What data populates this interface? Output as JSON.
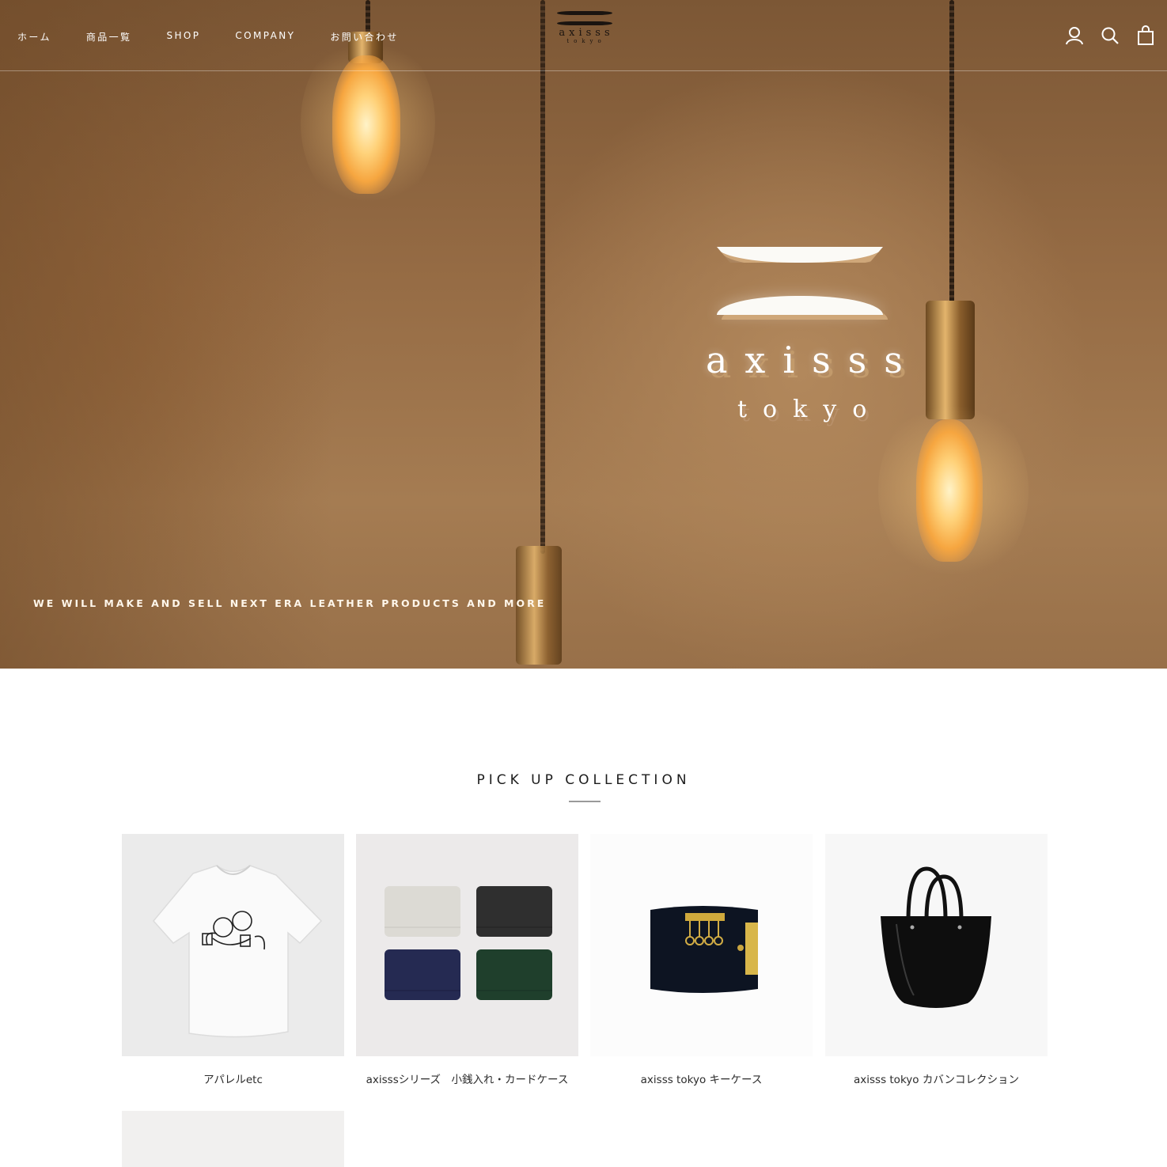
{
  "header": {
    "nav": [
      "ホーム",
      "商品一覧",
      "SHOP",
      "COMPANY",
      "お問い合わせ"
    ],
    "logo": {
      "word": "axisss",
      "sub": "tokyo"
    },
    "icons": [
      "account-icon",
      "search-icon",
      "cart-icon"
    ]
  },
  "hero": {
    "sign_word": "axisss",
    "sign_sub": "tokyo",
    "tagline": "WE WILL MAKE AND SELL NEXT ERA LEATHER PRODUCTS AND MORE"
  },
  "collection": {
    "title": "PICK UP COLLECTION",
    "items": [
      {
        "label": "アパレルetc",
        "image": "white-tshirt"
      },
      {
        "label": "axisssシリーズ　小銭入れ・カードケース",
        "image": "card-cases"
      },
      {
        "label": "axisss tokyo キーケース",
        "image": "key-case"
      },
      {
        "label": "axisss tokyo カバンコレクション",
        "image": "tote-bag"
      },
      {
        "label": "",
        "image": "partial-card"
      }
    ]
  },
  "colors": {
    "hero_brown": "#956b44",
    "text_dark": "#1c1c1c",
    "nav_text": "#ffffff"
  }
}
